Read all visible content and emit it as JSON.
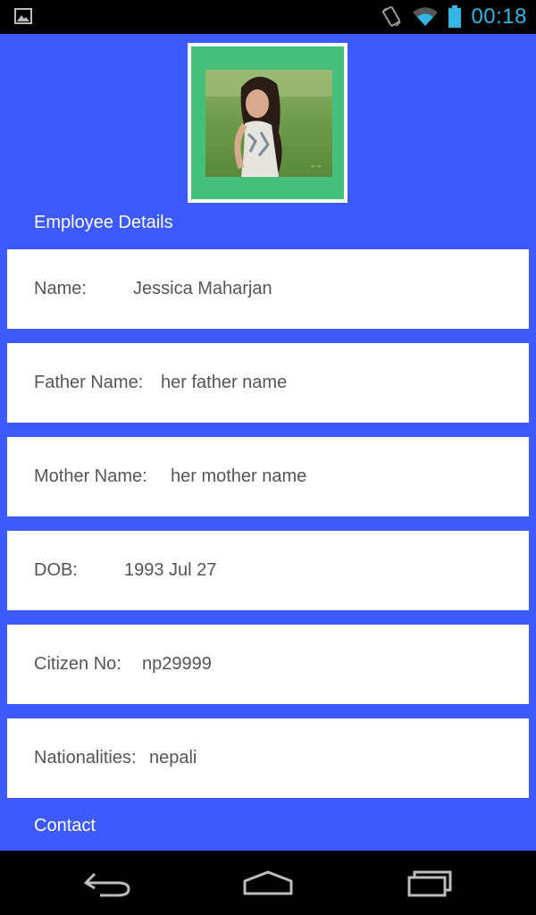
{
  "status_bar": {
    "time": "00:18",
    "icons": [
      "gallery-icon",
      "rotation-lock-icon",
      "wifi-icon",
      "battery-icon"
    ],
    "accent_color": "#33b5e5"
  },
  "profile": {
    "photo_alt": "employee-photo"
  },
  "sections": {
    "employee_details": "Employee Details",
    "contact": "Contact"
  },
  "fields": [
    {
      "label": "Name:",
      "value": "Jessica Maharjan"
    },
    {
      "label": "Father Name:",
      "value": "her father name"
    },
    {
      "label": "Mother Name:",
      "value": "her mother name"
    },
    {
      "label": "DOB:",
      "value": "1993 Jul 27"
    },
    {
      "label": "Citizen No:",
      "value": "np29999"
    },
    {
      "label": "Nationalities:",
      "value": "nepali"
    }
  ],
  "nav_bar": {
    "buttons": [
      "back-icon",
      "home-icon",
      "recents-icon"
    ]
  },
  "colors": {
    "background": "#3d5afe",
    "photo_frame": "#45bf7c",
    "card": "#ffffff",
    "text": "#555555"
  }
}
